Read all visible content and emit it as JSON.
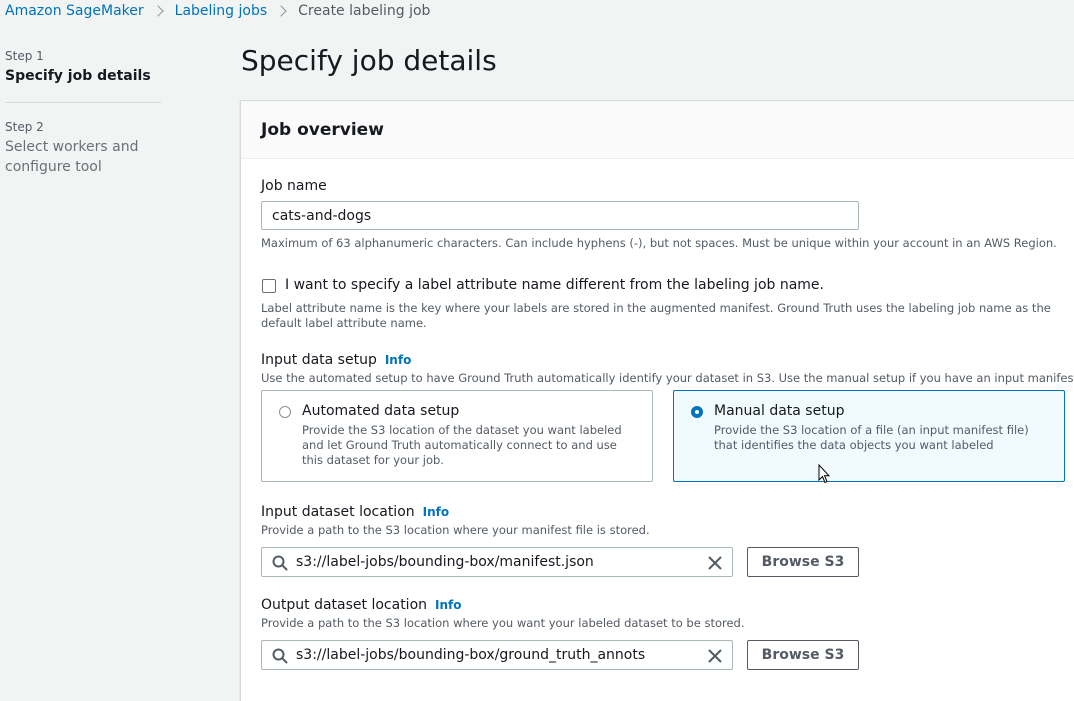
{
  "breadcrumb": {
    "items": [
      "Amazon SageMaker",
      "Labeling jobs"
    ],
    "current": "Create labeling job"
  },
  "steps": [
    {
      "number": "Step 1",
      "title": "Specify job details"
    },
    {
      "number": "Step 2",
      "title": "Select workers and configure tool"
    }
  ],
  "page_title": "Specify job details",
  "job_overview": {
    "heading": "Job overview",
    "job_name": {
      "label": "Job name",
      "value": "cats-and-dogs",
      "hint": "Maximum of 63 alphanumeric characters. Can include hyphens (-), but not spaces. Must be unique within your account in an AWS Region."
    },
    "label_attribute": {
      "checkbox_label": "I want to specify a label attribute name different from the labeling job name.",
      "checked": false,
      "hint": "Label attribute name is the key where your labels are stored in the augmented manifest. Ground Truth uses the labeling job name as the default label attribute name."
    },
    "input_data_setup": {
      "label": "Input data setup",
      "info": "Info",
      "description": "Use the automated setup to have Ground Truth automatically identify your dataset in S3. Use the manual setup if you have an input manifest file.",
      "options": [
        {
          "title": "Automated data setup",
          "description": "Provide the S3 location of the dataset you want labeled and let Ground Truth automatically connect to and use this dataset for your job.",
          "selected": false
        },
        {
          "title": "Manual data setup",
          "description": "Provide the S3 location of a file (an input manifest file) that identifies the data objects you want labeled",
          "selected": true
        }
      ]
    },
    "input_dataset_location": {
      "label": "Input dataset location",
      "info": "Info",
      "description": "Provide a path to the S3 location where your manifest file is stored.",
      "value": "s3://label-jobs/bounding-box/manifest.json",
      "browse_label": "Browse S3"
    },
    "output_dataset_location": {
      "label": "Output dataset location",
      "info": "Info",
      "description": "Provide a path to the S3 location where you want your labeled dataset to be stored.",
      "value": "s3://label-jobs/bounding-box/ground_truth_annots",
      "browse_label": "Browse S3"
    }
  },
  "colors": {
    "link": "#0073bb",
    "background": "#f2f3f3",
    "selected_tile_bg": "#f1faff"
  },
  "icons": [
    "chevron-right-icon",
    "search-icon",
    "clear-icon",
    "mouse-cursor-icon"
  ]
}
